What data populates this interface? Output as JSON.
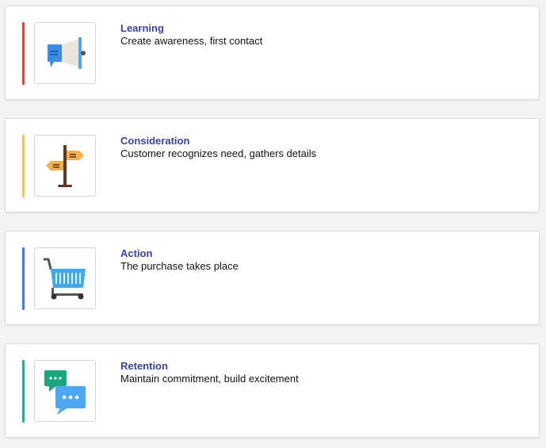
{
  "stages": [
    {
      "title": "Learning",
      "description": "Create awareness, first contact",
      "accent_color": "#e0413a",
      "icon": "megaphone-icon"
    },
    {
      "title": "Consideration",
      "description": "Customer recognizes need, gathers details",
      "accent_color": "#f1c350",
      "icon": "signpost-icon"
    },
    {
      "title": "Action",
      "description": "The purchase takes place",
      "accent_color": "#3c7de3",
      "icon": "shopping-cart-icon"
    },
    {
      "title": "Retention",
      "description": "Maintain commitment, build excitement",
      "accent_color": "#19b394",
      "icon": "chat-bubbles-icon"
    }
  ]
}
